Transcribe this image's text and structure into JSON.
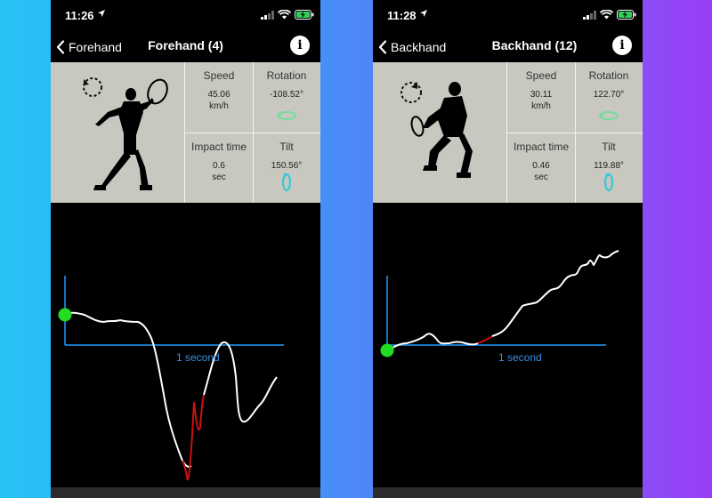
{
  "colors": {
    "accent": "#1f9bff",
    "panel": "#c8c8c0",
    "trace": "#ffffff",
    "impact": "#cc1111",
    "start_dot": "#22dd22",
    "tilt_icon": "#35c9d8",
    "rotation_icon": "#7ed9a0"
  },
  "screens": [
    {
      "status": {
        "time": "11:26"
      },
      "nav": {
        "back_label": "Forehand",
        "title": "Forehand (4)"
      },
      "stats": {
        "speed": {
          "label": "Speed",
          "value": "45.06",
          "unit": "km/h"
        },
        "rotation": {
          "label": "Rotation",
          "value": "-108.52°"
        },
        "impact_time": {
          "label": "Impact time",
          "value": "0.6",
          "unit": "sec"
        },
        "tilt": {
          "label": "Tilt",
          "value": "150.56°"
        }
      },
      "graph": {
        "time_label": "1 second"
      }
    },
    {
      "status": {
        "time": "11:28"
      },
      "nav": {
        "back_label": "Backhand",
        "title": "Backhand (12)"
      },
      "stats": {
        "speed": {
          "label": "Speed",
          "value": "30.11",
          "unit": "km/h"
        },
        "rotation": {
          "label": "Rotation",
          "value": "122.70°"
        },
        "impact_time": {
          "label": "Impact time",
          "value": "0.46",
          "unit": "sec"
        },
        "tilt": {
          "label": "Tilt",
          "value": "119.88°"
        }
      },
      "graph": {
        "time_label": "1 second"
      }
    }
  ]
}
